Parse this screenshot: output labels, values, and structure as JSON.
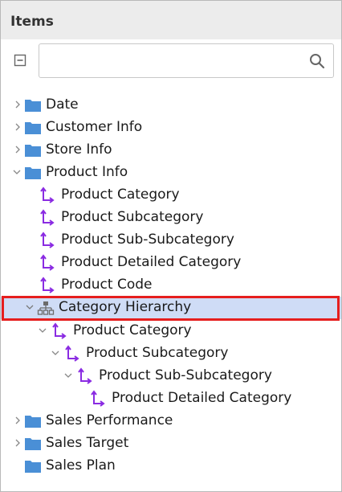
{
  "panel": {
    "title": "Items"
  },
  "search": {
    "value": "",
    "placeholder": ""
  },
  "tree": {
    "date": "Date",
    "customer_info": "Customer Info",
    "store_info": "Store Info",
    "product_info": "Product Info",
    "product_category": "Product Category",
    "product_subcategory": "Product Subcategory",
    "product_sub_subcategory": "Product Sub-Subcategory",
    "product_detailed_category": "Product Detailed Category",
    "product_code": "Product Code",
    "category_hierarchy": "Category Hierarchy",
    "h_product_category": "Product Category",
    "h_product_subcategory": "Product Subcategory",
    "h_product_sub_subcategory": "Product Sub-Subcategory",
    "h_product_detailed_category": "Product Detailed Category",
    "sales_performance": "Sales Performance",
    "sales_target": "Sales Target",
    "sales_plan": "Sales Plan"
  },
  "colors": {
    "folder": "#4a8fd6",
    "level": "#8a2be2",
    "selection": "#cfdcf6",
    "highlight_border": "#e61e1e"
  }
}
